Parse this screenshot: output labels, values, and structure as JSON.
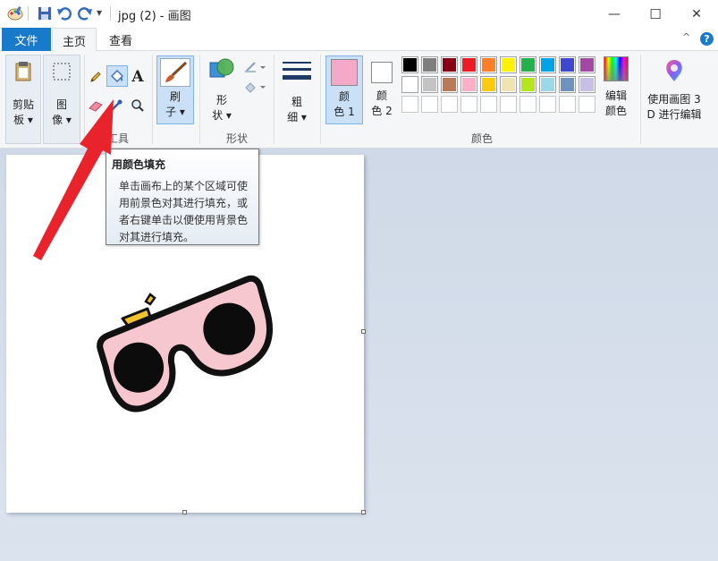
{
  "window": {
    "title": "jpg (2) - 画图",
    "minimize_glyph": "—",
    "maximize_glyph": "☐",
    "close_glyph": "✕"
  },
  "quick_access": {
    "dropdown_glyph": "▾"
  },
  "tabs": {
    "file": "文件",
    "home": "主页",
    "view": "查看",
    "collapse_glyph": "^",
    "help_glyph": "?"
  },
  "ribbon": {
    "clipboard": {
      "line1": "剪贴",
      "line2": "板 ▾"
    },
    "image": {
      "line1": "图",
      "line2": "像 ▾"
    },
    "tools_label": "工具",
    "text_tool_glyph": "A",
    "brush": {
      "line1": "刷",
      "line2": "子 ▾"
    },
    "shapes": {
      "line1": "形",
      "line2": "状 ▾"
    },
    "shapes_label": "形状",
    "size": {
      "line1": "粗",
      "line2": "细 ▾"
    },
    "color1": {
      "line1": "颜",
      "line2": "色 1"
    },
    "color2": {
      "line1": "颜",
      "line2": "色 2"
    },
    "edit_colors": {
      "line1": "编辑",
      "line2": "颜色"
    },
    "colors_label": "颜色",
    "paint3d": {
      "line1": "使用画图 3",
      "line2": "D 进行编辑"
    }
  },
  "colors": {
    "color1": "#f4a9c8",
    "color2": "#ffffff",
    "palette_row1": [
      "#000000",
      "#7f7f7f",
      "#880015",
      "#ed1c24",
      "#ff7f27",
      "#fff200",
      "#22b14c",
      "#00a2e8",
      "#3f48cc",
      "#a349a4"
    ],
    "palette_row2": [
      "#ffffff",
      "#c3c3c3",
      "#b97a57",
      "#ffaec9",
      "#ffc90e",
      "#efe4b0",
      "#b5e61d",
      "#99d9ea",
      "#7092be",
      "#c8bfe7"
    ],
    "accent": "#1979ca",
    "arrow": "#e8232b"
  },
  "tooltip": {
    "title": "用颜色填充",
    "body": "单击画布上的某个区域可使用前景色对其进行填充，或者右键单击以便使用背景色对其进行填充。"
  }
}
